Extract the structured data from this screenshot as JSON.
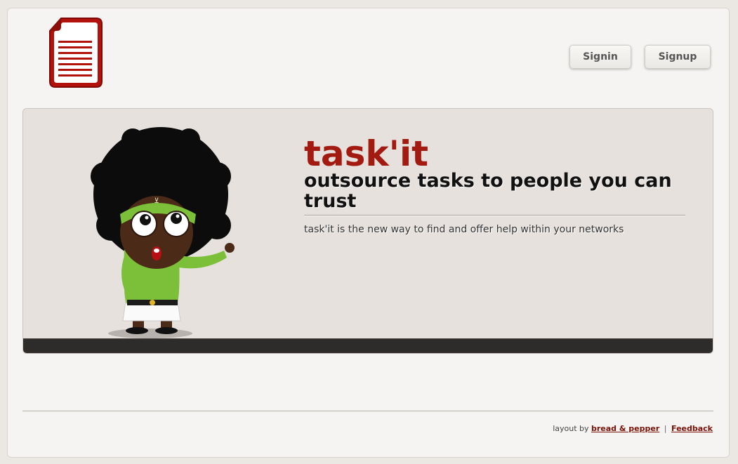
{
  "header": {
    "logo_icon": "document-icon",
    "signin_label": "Signin",
    "signup_label": "Signup"
  },
  "hero": {
    "title": "task'it",
    "tagline": "outsource tasks to people you can trust",
    "description": "task'it is the new way to find and offer help within your networks",
    "mascot": "cartoon-character-illustration"
  },
  "footer": {
    "layout_prefix": "layout by",
    "layout_link": "bread & pepper",
    "separator": "|",
    "feedback_link": "Feedback"
  },
  "colors": {
    "brand_red": "#a31a10",
    "background": "#f5f4f2",
    "hero_background": "#e6e1dc",
    "hero_bar": "#2e2c2b"
  }
}
